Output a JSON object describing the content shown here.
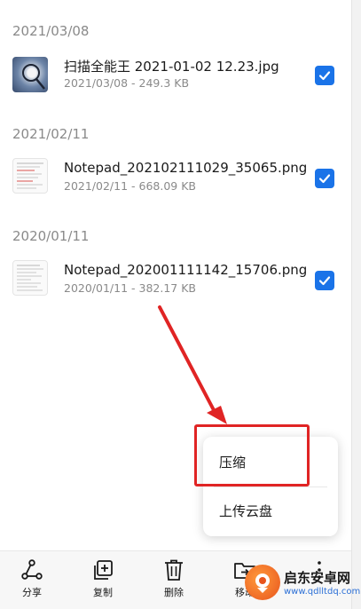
{
  "file_groups": [
    {
      "date": "2021/03/08",
      "file": {
        "name": "扫描全能王 2021-01-02 12.23.jpg",
        "meta": "2021/03/08 - 249.3 KB",
        "thumbnail": "photo-thumbnail",
        "checked": true
      }
    },
    {
      "date": "2021/02/11",
      "file": {
        "name": "Notepad_202102111029_35065.png",
        "meta": "2021/02/11 - 668.09 KB",
        "thumbnail": "document-thumbnail",
        "checked": true
      }
    },
    {
      "date": "2020/01/11",
      "file": {
        "name": "Notepad_202001111142_15706.png",
        "meta": "2020/01/11 - 382.17 KB",
        "thumbnail": "document-thumbnail",
        "checked": true
      }
    }
  ],
  "popup_menu": {
    "items": [
      {
        "label": "压缩",
        "highlighted": true
      },
      {
        "label": "上传云盘",
        "highlighted": false
      }
    ]
  },
  "toolbar": {
    "items": [
      {
        "icon": "share-icon",
        "label": "分享"
      },
      {
        "icon": "copy-icon",
        "label": "复制"
      },
      {
        "icon": "delete-icon",
        "label": "删除"
      },
      {
        "icon": "move-icon",
        "label": "移动"
      },
      {
        "icon": "more-icon",
        "label": ""
      }
    ]
  },
  "watermark": {
    "title": "启东安卓网",
    "url": "www.qdlltdq.com"
  },
  "colors": {
    "checkbox": "#1a73e8",
    "annotation": "#e02424",
    "watermark_orange": "#e8541c"
  }
}
